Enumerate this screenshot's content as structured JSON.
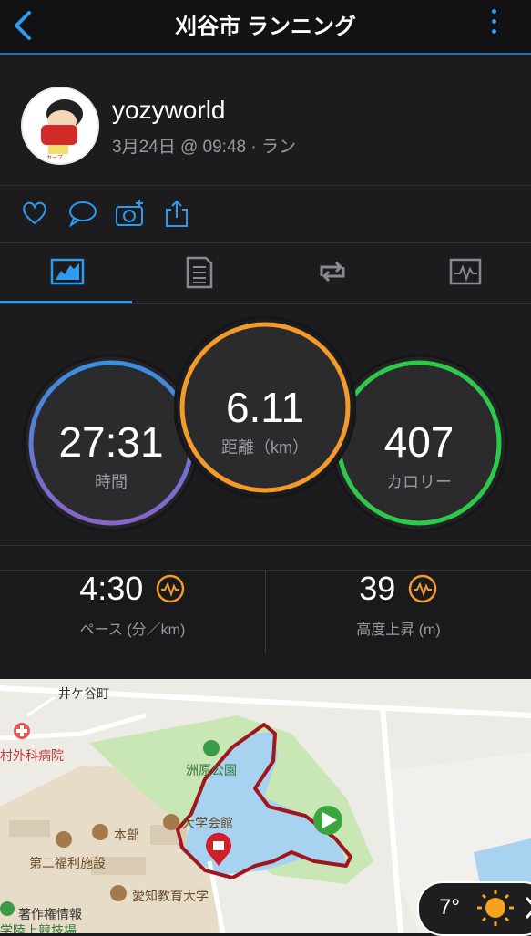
{
  "header": {
    "title": "刈谷市 ランニング"
  },
  "profile": {
    "username": "yozyworld",
    "subline": "3月24日 @ 09:48 · ラン"
  },
  "stats": {
    "time": {
      "value": "27:31",
      "label": "時間"
    },
    "distance": {
      "value": "6.11",
      "label": "距離（km）"
    },
    "calories": {
      "value": "407",
      "label": "カロリー"
    }
  },
  "metrics": {
    "pace": {
      "value": "4:30",
      "label": "ペース (分／km)"
    },
    "ascent": {
      "value": "39",
      "label": "高度上昇 (m)"
    }
  },
  "map": {
    "labels": {
      "town": "井ケ谷町",
      "hospital": "村外科病院",
      "park": "洲原公園",
      "hall": "大学会館",
      "hq": "本部",
      "welfare": "第二福利施設",
      "univ": "愛知教育大学",
      "copyright": "著作権情報",
      "track": "学陸上競技場"
    }
  },
  "weather": {
    "temp": "7°"
  },
  "colors": {
    "accent": "#2d9bf0",
    "route": "#a0151e",
    "time": "#7b5fc7",
    "distance": "#f39a2b",
    "calories": "#2ec84a"
  }
}
